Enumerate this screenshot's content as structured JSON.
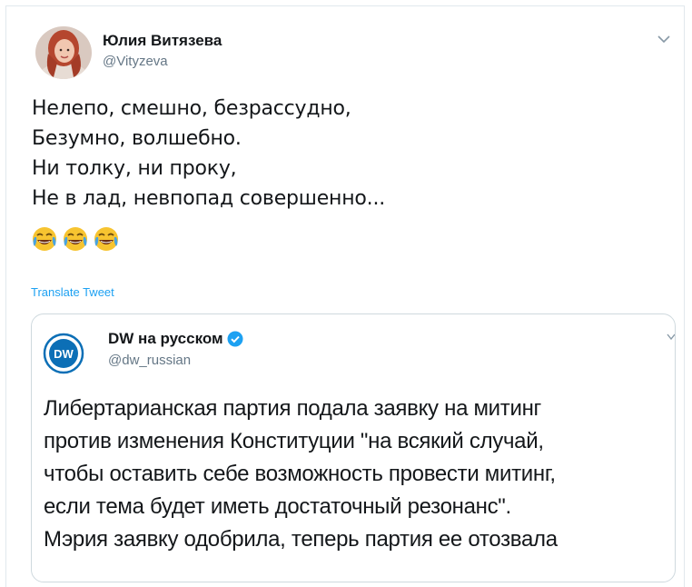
{
  "tweet": {
    "author_name": "Юлия Витязева",
    "author_handle": "@Vityzeva",
    "lines": [
      "Нелепо, смешно, безрассудно,",
      "Безумно, волшебно.",
      "Ни толку, ни проку,",
      "Не в лад, невпопад совершенно..."
    ],
    "emojis": [
      "face-with-tears-of-joy",
      "face-with-tears-of-joy",
      "face-with-tears-of-joy"
    ],
    "translate_label": "Translate Tweet"
  },
  "quoted": {
    "author_name": "DW на русском",
    "author_handle": "@dw_russian",
    "verified": true,
    "logo_text": "DW",
    "lines": [
      "Либертарианская партия подала заявку на митинг",
      "против изменения Конституции \"на всякий случай,",
      "чтобы оставить себе возможность провести митинг,",
      "если тема будет иметь достаточный резонанс\".",
      "Мэрия заявку одобрила, теперь партия ее отозвала"
    ]
  },
  "colors": {
    "link": "#1da1f2",
    "text": "#14171a",
    "secondary": "#657786",
    "verified": "#1da1f2",
    "dw_blue": "#0c6fb6"
  }
}
